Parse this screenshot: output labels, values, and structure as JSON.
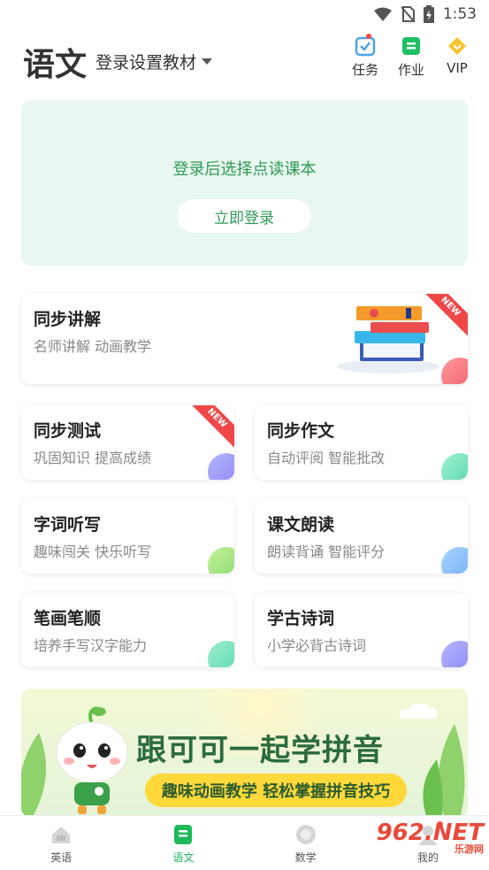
{
  "status_bar": {
    "time": "1:53"
  },
  "header": {
    "subject": "语文",
    "textbook_selector": "登录设置教材",
    "tools": [
      {
        "label": "任务",
        "icon": "task-icon",
        "color": "#4aa3ea"
      },
      {
        "label": "作业",
        "icon": "homework-icon",
        "color": "#1fbf64"
      },
      {
        "label": "VIP",
        "icon": "vip-diamond-icon",
        "color": "#f6c32b"
      }
    ]
  },
  "login_card": {
    "prompt": "登录后选择点读课本",
    "button": "立即登录"
  },
  "features": [
    {
      "title": "同步讲解",
      "desc": "名师讲解  动画教学",
      "badge": "NEW"
    },
    {
      "title": "同步测试",
      "desc": "巩固知识 提高成绩",
      "badge": "NEW"
    },
    {
      "title": "同步作文",
      "desc": "自动评阅  智能批改"
    },
    {
      "title": "字词听写",
      "desc": "趣味闯关 快乐听写"
    },
    {
      "title": "课文朗读",
      "desc": "朗读背诵 智能评分"
    },
    {
      "title": "笔画笔顺",
      "desc": "培养手写汉字能力"
    },
    {
      "title": "学古诗词",
      "desc": "小学必背古诗词"
    }
  ],
  "banner": {
    "headline": "跟可可一起学拼音",
    "subtitle": "趣味动画教学 轻松掌握拼音技巧"
  },
  "bottom_nav": [
    {
      "label": "英语",
      "icon": "english-icon"
    },
    {
      "label": "语文",
      "icon": "chinese-book-icon",
      "active": true
    },
    {
      "label": "数学",
      "icon": "math-icon"
    },
    {
      "label": "我的",
      "icon": "profile-icon"
    }
  ],
  "watermark": {
    "text": "962.NET",
    "sub": "乐游网"
  },
  "colors": {
    "accent": "#1db95a",
    "login_bg": "#e8f7ef",
    "login_text": "#2f9a55",
    "badge": "#ef4747"
  }
}
